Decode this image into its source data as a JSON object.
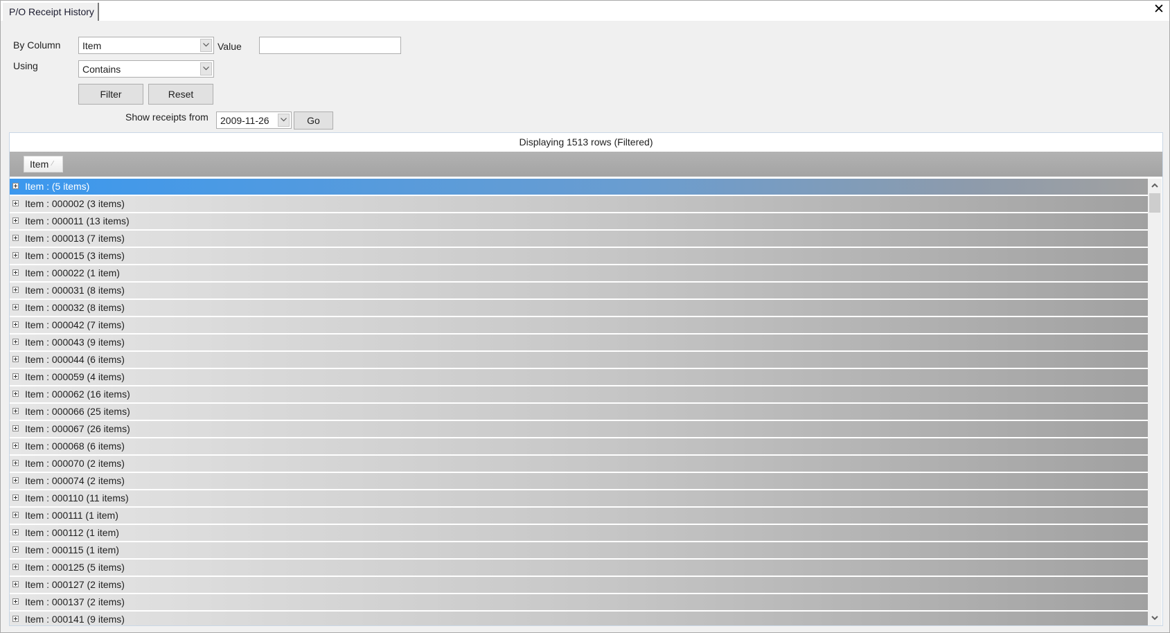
{
  "window": {
    "tab_title": "P/O Receipt History",
    "close_icon": "close-icon"
  },
  "filter": {
    "by_column_label": "By Column",
    "by_column_value": "Item",
    "value_label": "Value",
    "value_input": "",
    "using_label": "Using",
    "using_value": "Contains",
    "filter_button": "Filter",
    "reset_button": "Reset",
    "show_receipts_label": "Show receipts from",
    "date_value": "2009-11-26",
    "go_button": "Go"
  },
  "grid": {
    "status": "Displaying 1513 rows (Filtered)",
    "group_by_column": "Item",
    "group_sort_icon": "sort-ascending-icon",
    "rows": [
      {
        "label": "Item :  (5 items)",
        "selected": true
      },
      {
        "label": "Item : 000002 (3 items)"
      },
      {
        "label": "Item : 000011 (13 items)"
      },
      {
        "label": "Item : 000013 (7 items)"
      },
      {
        "label": "Item : 000015 (3 items)"
      },
      {
        "label": "Item : 000022 (1 item)"
      },
      {
        "label": "Item : 000031 (8 items)"
      },
      {
        "label": "Item : 000032 (8 items)"
      },
      {
        "label": "Item : 000042 (7 items)"
      },
      {
        "label": "Item : 000043 (9 items)"
      },
      {
        "label": "Item : 000044 (6 items)"
      },
      {
        "label": "Item : 000059 (4 items)"
      },
      {
        "label": "Item : 000062 (16 items)"
      },
      {
        "label": "Item : 000066 (25 items)"
      },
      {
        "label": "Item : 000067 (26 items)"
      },
      {
        "label": "Item : 000068 (6 items)"
      },
      {
        "label": "Item : 000070 (2 items)"
      },
      {
        "label": "Item : 000074 (2 items)"
      },
      {
        "label": "Item : 000110 (11 items)"
      },
      {
        "label": "Item : 000111 (1 item)"
      },
      {
        "label": "Item : 000112 (1 item)"
      },
      {
        "label": "Item : 000115 (1 item)"
      },
      {
        "label": "Item : 000125 (5 items)"
      },
      {
        "label": "Item : 000127 (2 items)"
      },
      {
        "label": "Item : 000137 (2 items)"
      },
      {
        "label": "Item : 000141 (9 items)"
      }
    ]
  },
  "colors": {
    "selection": "#3b98ee",
    "group_panel": "#a9a9a9",
    "background": "#f0f0f0"
  }
}
